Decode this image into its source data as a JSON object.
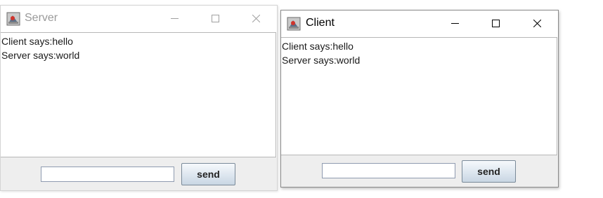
{
  "server_window": {
    "title": "Server",
    "icon": "java-app-icon",
    "messages": [
      "Client says:hello",
      "Server says:world"
    ],
    "input_value": "",
    "send_label": "send"
  },
  "client_window": {
    "title": "Client",
    "icon": "java-app-icon",
    "messages": [
      "Client says:hello",
      "Server says:world"
    ],
    "input_value": "",
    "send_label": "send"
  }
}
